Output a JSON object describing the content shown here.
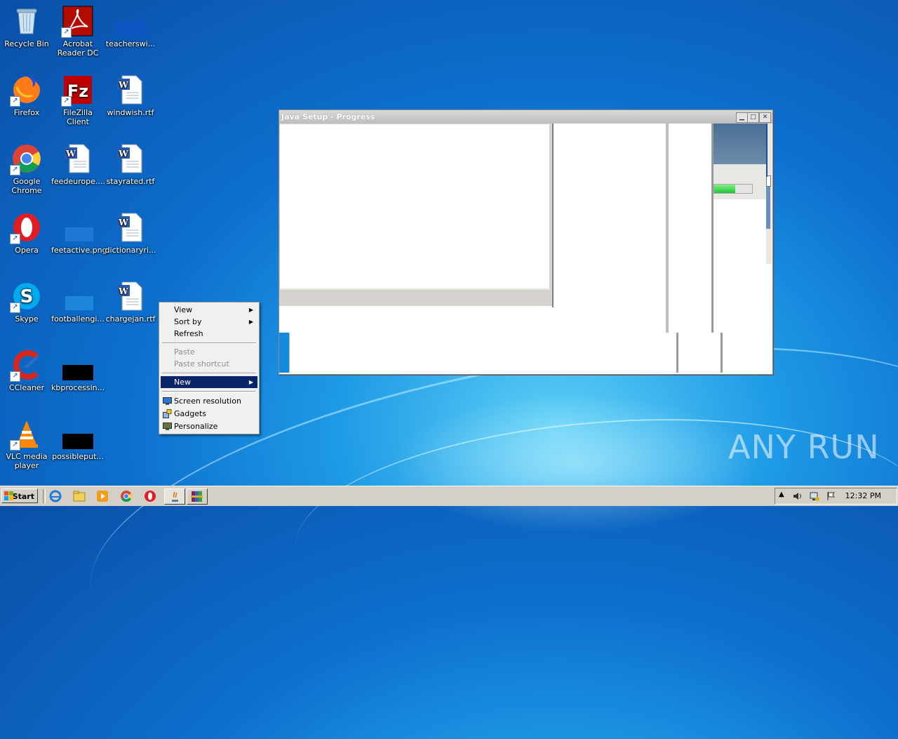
{
  "desktop": {
    "icons": [
      {
        "label": "Recycle Bin",
        "icon": "recycle-bin-icon"
      },
      {
        "label": "Acrobat Reader DC",
        "icon": "acrobat-icon"
      },
      {
        "label": "teacherswi...",
        "icon": "file-icon"
      },
      {
        "label": "Firefox",
        "icon": "firefox-icon"
      },
      {
        "label": "FileZilla Client",
        "icon": "filezilla-icon"
      },
      {
        "label": "windwish.rtf",
        "icon": "word-doc-icon"
      },
      {
        "label": "Google Chrome",
        "icon": "chrome-icon"
      },
      {
        "label": "feedeurope....",
        "icon": "word-doc-icon"
      },
      {
        "label": "stayrated.rtf",
        "icon": "word-doc-icon"
      },
      {
        "label": "Opera",
        "icon": "opera-icon"
      },
      {
        "label": "feetactive.png",
        "icon": "image-icon"
      },
      {
        "label": "dictionaryri...",
        "icon": "word-doc-icon"
      },
      {
        "label": "Skype",
        "icon": "skype-icon"
      },
      {
        "label": "footballengi...",
        "icon": "image-icon"
      },
      {
        "label": "chargejan.rtf",
        "icon": "word-doc-icon"
      },
      {
        "label": "CCleaner",
        "icon": "ccleaner-icon"
      },
      {
        "label": "kbprocessin...",
        "icon": "black-file-icon"
      },
      {
        "label": "VLC media player",
        "icon": "vlc-icon"
      },
      {
        "label": "possibleput...",
        "icon": "black-file-icon"
      }
    ]
  },
  "window": {
    "title": "Java Setup - Progress",
    "progress_fraction": 0.55
  },
  "context_menu": {
    "items": [
      {
        "label": "View",
        "submenu": true,
        "disabled": false
      },
      {
        "label": "Sort by",
        "submenu": true,
        "disabled": false
      },
      {
        "label": "Refresh",
        "submenu": false,
        "disabled": false
      },
      {
        "label": "Paste",
        "submenu": false,
        "disabled": true
      },
      {
        "label": "Paste shortcut",
        "submenu": false,
        "disabled": true
      },
      {
        "label": "New",
        "submenu": true,
        "disabled": false,
        "highlighted": true
      },
      {
        "label": "Screen resolution",
        "submenu": false,
        "disabled": false
      },
      {
        "label": "Gadgets",
        "submenu": false,
        "disabled": false
      },
      {
        "label": "Personalize",
        "submenu": false,
        "disabled": false
      }
    ]
  },
  "taskbar": {
    "start_label": "Start",
    "pinned": [
      "ie-icon",
      "explorer-icon",
      "media-player-icon",
      "chrome-icon",
      "opera-icon",
      "java-setup-icon",
      "winrar-icon"
    ],
    "clock": "12:32 PM"
  },
  "watermark": "ANY RUN"
}
